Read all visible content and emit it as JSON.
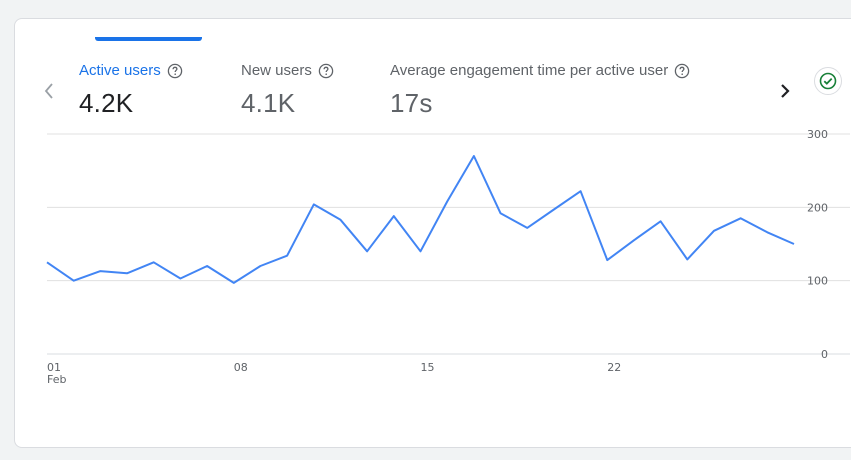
{
  "metrics": [
    {
      "label": "Active users",
      "value": "4.2K",
      "active": true
    },
    {
      "label": "New users",
      "value": "4.1K",
      "active": false
    },
    {
      "label": "Average engagement time per active user",
      "value": "17s",
      "active": false
    }
  ],
  "icons": {
    "prev": "chevron-left-icon",
    "next": "chevron-right-icon",
    "help": "help-circle-icon",
    "status": "check-circle-icon"
  },
  "colors": {
    "accent": "#1a73e8",
    "line": "#4285f4",
    "grid": "#e0e0e0",
    "status": "#188038"
  },
  "chart_data": {
    "type": "line",
    "x": [
      "01 Feb",
      "02",
      "03",
      "04",
      "05",
      "06",
      "07",
      "08",
      "09",
      "10",
      "11",
      "12",
      "13",
      "14",
      "15",
      "16",
      "17",
      "18",
      "19",
      "20",
      "21",
      "22",
      "23",
      "24",
      "25",
      "26",
      "27",
      "28",
      "29"
    ],
    "series": [
      {
        "values": [
          125,
          100,
          113,
          110,
          125,
          103,
          120,
          97,
          120,
          134,
          204,
          183,
          140,
          188,
          140,
          208,
          270,
          192,
          172,
          197,
          222,
          128,
          155,
          181,
          129,
          168,
          185,
          166,
          150
        ]
      }
    ],
    "xticks": [
      {
        "index": 0,
        "label": "01",
        "sublabel": "Feb"
      },
      {
        "index": 7,
        "label": "08",
        "sublabel": ""
      },
      {
        "index": 14,
        "label": "15",
        "sublabel": ""
      },
      {
        "index": 21,
        "label": "22",
        "sublabel": ""
      }
    ],
    "yticks": [
      0,
      100,
      200,
      300
    ],
    "ylim": [
      0,
      300
    ],
    "grid": true,
    "yaxis_position": "right"
  }
}
